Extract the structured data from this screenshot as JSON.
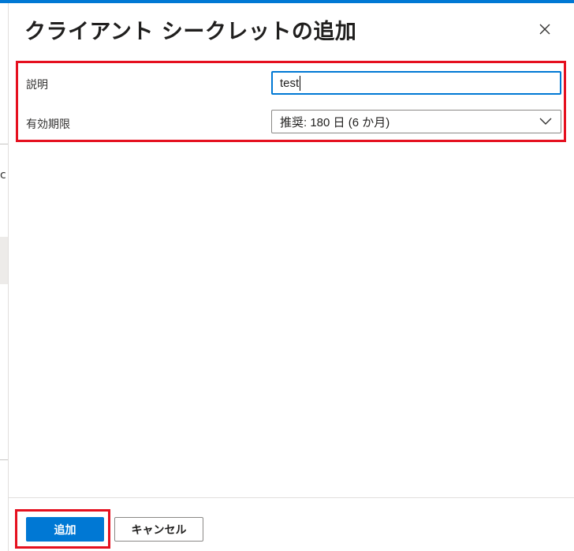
{
  "dialog": {
    "title": "クライアント シークレットの追加",
    "close_icon": "close-icon"
  },
  "form": {
    "description": {
      "label": "説明",
      "value": "test"
    },
    "expiration": {
      "label": "有効期限",
      "selected": "推奨: 180 日 (6 か月)",
      "icon": "chevron-down-icon"
    }
  },
  "footer": {
    "add_label": "追加",
    "cancel_label": "キャンセル"
  },
  "background": {
    "fragment": "c"
  },
  "colors": {
    "accent": "#0078d4",
    "highlight": "#e5101f",
    "border": "#8a8886"
  }
}
